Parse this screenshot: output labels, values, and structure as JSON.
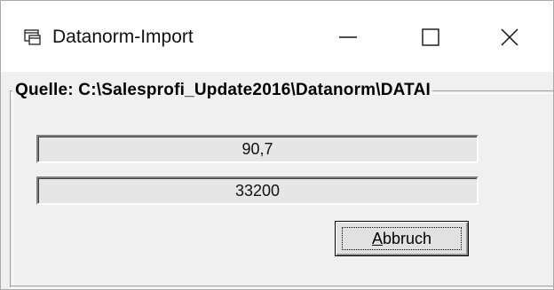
{
  "window": {
    "title": "Datanorm-Import",
    "app_icon": "window-app-icon",
    "controls": {
      "minimize_icon": "minimize-icon",
      "maximize_icon": "maximize-icon",
      "close_icon": "close-icon"
    }
  },
  "group": {
    "label": "Quelle: C:\\Salesprofi_Update2016\\Datanorm\\DATAI"
  },
  "progress": [
    {
      "text": "90,7"
    },
    {
      "text": "33200"
    }
  ],
  "buttons": {
    "cancel": {
      "mnemonic": "A",
      "rest": "bbruch"
    }
  },
  "colors": {
    "titlebar_bg": "#ffffff",
    "client_bg": "#f0f0f0",
    "button_bg": "#e1e1e1",
    "progress_bg": "#e6e6e6"
  }
}
